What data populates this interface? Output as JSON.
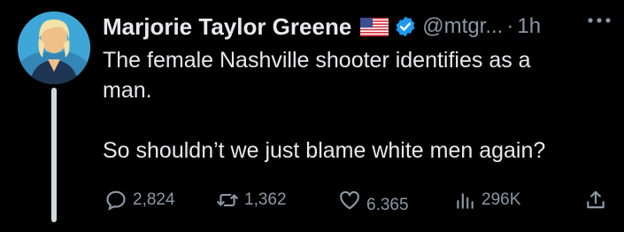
{
  "tweet": {
    "author_name": "Marjorie Taylor Greene",
    "flag_icon": "us-flag-icon",
    "verified_icon": "verified-badge-icon",
    "handle": "@mtgr...",
    "separator": "·",
    "time": "1h",
    "more_icon": "more-options-icon",
    "text_lines": [
      "The female Nashville shooter identifies as a",
      "man.",
      "So shouldn’t we just blame white men again?"
    ],
    "actions": {
      "replies": "2,824",
      "retweets": "1,362",
      "likes": "6.365",
      "views": "296K"
    },
    "colors": {
      "background": "#000000",
      "text": "#e7e9ea",
      "muted": "#8b98a5",
      "verified_blue": "#1d9bf0",
      "thread_line": "#cfd9de"
    }
  }
}
